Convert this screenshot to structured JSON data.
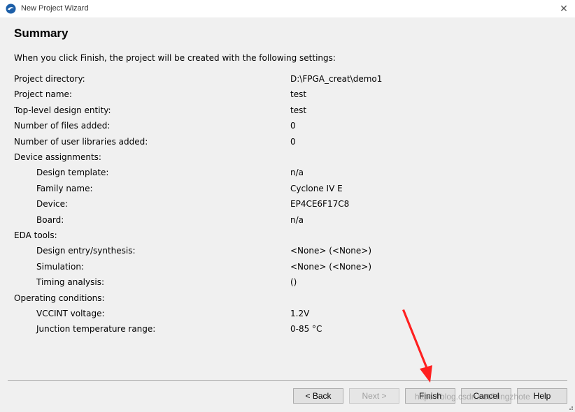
{
  "window": {
    "title": "New Project Wizard",
    "close_glyph": "✕"
  },
  "page": {
    "heading": "Summary",
    "intro": "When you click Finish, the project will be created with the following settings:"
  },
  "settings": [
    {
      "label": "Project directory:",
      "value": "D:\\FPGA_creat\\demo1",
      "indent": false
    },
    {
      "label": "Project name:",
      "value": "test",
      "indent": false
    },
    {
      "label": "Top-level design entity:",
      "value": "test",
      "indent": false
    },
    {
      "label": "Number of files added:",
      "value": "0",
      "indent": false
    },
    {
      "label": "Number of user libraries added:",
      "value": "0",
      "indent": false
    },
    {
      "label": "Device assignments:",
      "value": "",
      "indent": false
    },
    {
      "label": "Design template:",
      "value": "n/a",
      "indent": true
    },
    {
      "label": "Family name:",
      "value": "Cyclone IV E",
      "indent": true
    },
    {
      "label": "Device:",
      "value": "EP4CE6F17C8",
      "indent": true
    },
    {
      "label": "Board:",
      "value": "n/a",
      "indent": true
    },
    {
      "label": "EDA tools:",
      "value": "",
      "indent": false
    },
    {
      "label": "Design entry/synthesis:",
      "value": "<None> (<None>)",
      "indent": true
    },
    {
      "label": "Simulation:",
      "value": "<None> (<None>)",
      "indent": true
    },
    {
      "label": "Timing analysis:",
      "value": " ()",
      "indent": true
    },
    {
      "label": "Operating conditions:",
      "value": "",
      "indent": false
    },
    {
      "label": "VCCINT voltage:",
      "value": "1.2V",
      "indent": true
    },
    {
      "label": "Junction temperature range:",
      "value": "0-85 °C",
      "indent": true
    }
  ],
  "buttons": {
    "back": "< Back",
    "next": "Next >",
    "finish": "Finish",
    "cancel": "Cancel",
    "help": "Help"
  },
  "watermark": "https://blog.csdn.net/Ningzhote",
  "colors": {
    "background": "#f0f0f0",
    "annotation_arrow": "#ff2020",
    "app_icon": "#1d5fa8"
  }
}
